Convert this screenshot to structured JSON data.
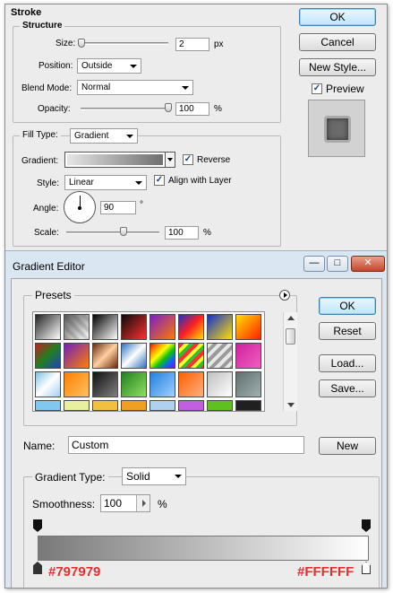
{
  "stroke": {
    "title": "Stroke",
    "structure": {
      "legend": "Structure",
      "size": {
        "label": "Size:",
        "value": "2",
        "unit": "px"
      },
      "position": {
        "label": "Position:",
        "value": "Outside"
      },
      "blend_mode": {
        "label": "Blend Mode:",
        "value": "Normal"
      },
      "opacity": {
        "label": "Opacity:",
        "value": "100",
        "unit": "%"
      }
    },
    "fill": {
      "legend": "Fill Type:",
      "fill_type": "Gradient",
      "gradient_label": "Gradient:",
      "reverse": {
        "label": "Reverse",
        "checked": true
      },
      "style": {
        "label": "Style:",
        "value": "Linear"
      },
      "align": {
        "label": "Align with Layer",
        "checked": true
      },
      "angle": {
        "label": "Angle:",
        "value": "90",
        "unit": "°"
      },
      "scale": {
        "label": "Scale:",
        "value": "100",
        "unit": "%"
      }
    },
    "buttons": {
      "ok": "OK",
      "cancel": "Cancel",
      "new_style": "New Style..."
    },
    "preview": {
      "label": "Preview",
      "checked": true
    }
  },
  "gradient_editor": {
    "title": "Gradient Editor",
    "window_controls": {
      "minimize": "—",
      "maximize": "□",
      "close": "✕"
    },
    "presets_label": "Presets",
    "buttons": {
      "ok": "OK",
      "reset": "Reset",
      "load": "Load...",
      "save": "Save...",
      "new": "New"
    },
    "name": {
      "label": "Name:",
      "value": "Custom"
    },
    "gradient_type": {
      "label": "Gradient Type:",
      "value": "Solid"
    },
    "smoothness": {
      "label": "Smoothness:",
      "value": "100",
      "unit": "%"
    },
    "stops": {
      "left_color": "#797979",
      "right_color": "#FFFFFF"
    },
    "colors": {
      "left": "#797979",
      "right": "#FFFFFF",
      "annotation": "#e03030"
    }
  }
}
